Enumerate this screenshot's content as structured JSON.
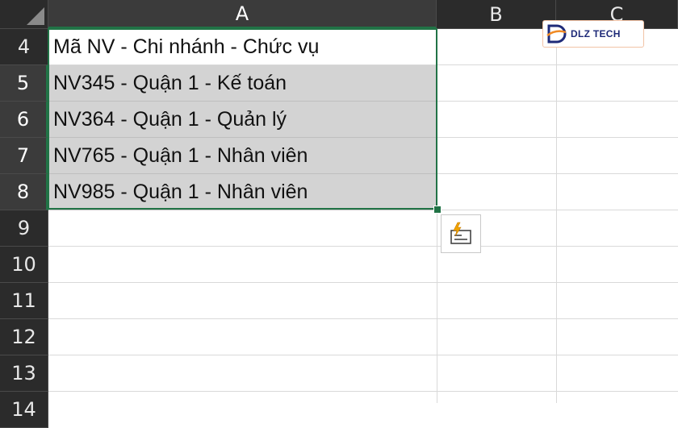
{
  "columns": [
    "A",
    "B",
    "C"
  ],
  "rows": [
    "4",
    "5",
    "6",
    "7",
    "8",
    "9",
    "10",
    "11",
    "12",
    "13",
    "14"
  ],
  "cells": {
    "r4": "Mã NV - Chi nhánh - Chức vụ",
    "r5": "NV345 - Quận 1 - Kế toán",
    "r6": "NV364 - Quận 1 - Quản lý",
    "r7": "NV765 - Quận 1 - Nhân viên",
    "r8": "NV985 - Quận 1 - Nhân viên"
  },
  "logo": {
    "text": "DLZ TECH",
    "icon": "dlz-tech-logo-icon"
  },
  "quick_analysis": {
    "icon": "flash-fill-options-icon"
  },
  "colors": {
    "accent": "#217346",
    "header_bg": "#2b2b2b",
    "selection_fill": "#d3d3d3",
    "logo_orange": "#f08a24",
    "logo_navy": "#1e2a78"
  }
}
